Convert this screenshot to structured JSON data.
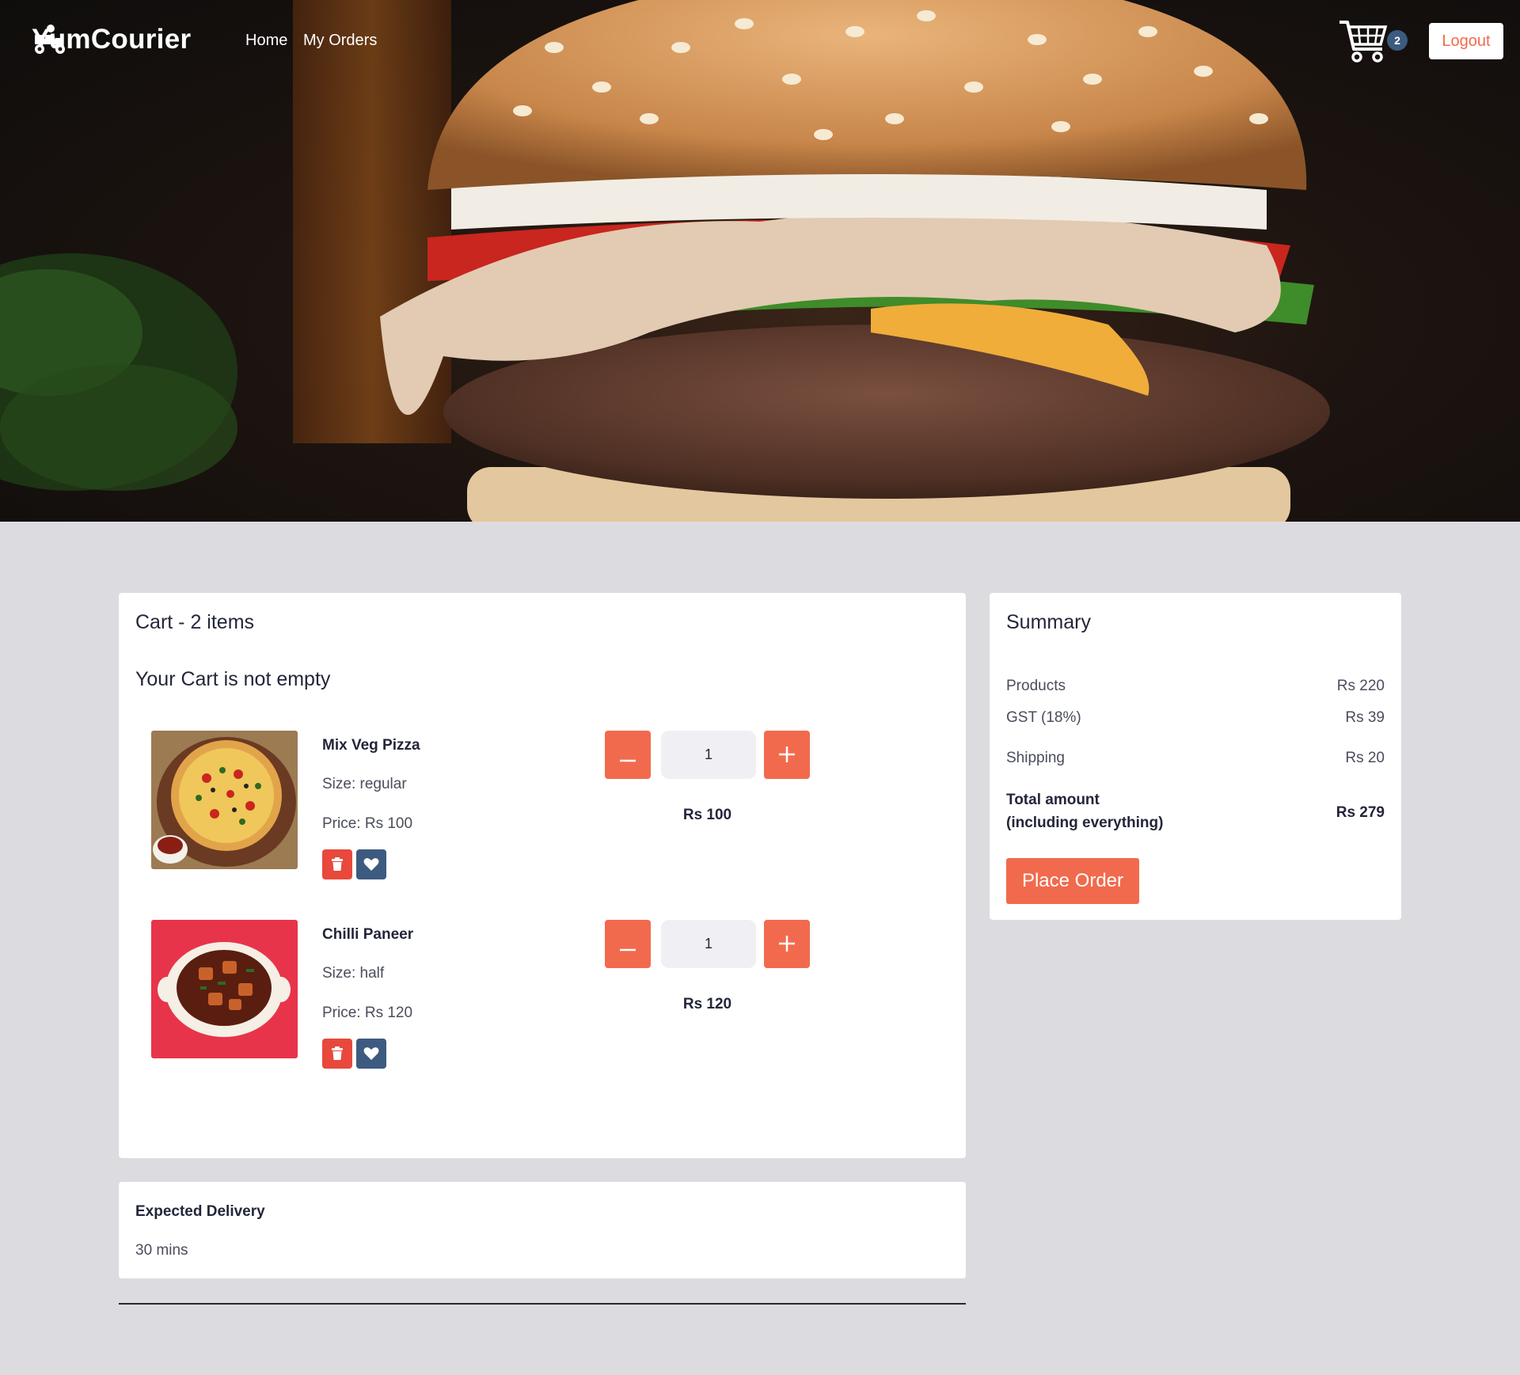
{
  "brand": {
    "name": "YumCourier",
    "icon": "delivery-scooter-icon"
  },
  "nav": {
    "links": [
      "Home",
      "My Orders"
    ],
    "cart_count": "2",
    "logout": "Logout"
  },
  "hero": {
    "image": "burger-photo"
  },
  "cart": {
    "title": "Cart - 2 items",
    "subtitle": "Your Cart is not empty",
    "items": [
      {
        "name": "Mix Veg Pizza",
        "size": "Size: regular",
        "price": "Price: Rs 100",
        "quantity": "1",
        "total": "Rs 100",
        "image": "pizza-photo"
      },
      {
        "name": "Chilli Paneer",
        "size": "Size: half",
        "price": "Price: Rs 120",
        "quantity": "1",
        "total": "Rs 120",
        "image": "chilli-paneer-photo"
      }
    ],
    "icons": {
      "delete": "trash-icon",
      "favorite": "heart-icon",
      "decrease": "minus-icon",
      "increase": "plus-icon"
    }
  },
  "summary": {
    "title": "Summary",
    "rows": [
      {
        "label": "Products",
        "value": "Rs 220"
      },
      {
        "label": "GST (18%)",
        "value": "Rs 39"
      },
      {
        "label": "Shipping",
        "value": "Rs 20"
      }
    ],
    "total_label_1": "Total amount",
    "total_label_2": "(including everything)",
    "total_value": "Rs 279",
    "button": "Place Order"
  },
  "delivery": {
    "label": "Expected Delivery",
    "value": "30 mins"
  },
  "colors": {
    "accent": "#f26a4d",
    "danger": "#e8493c",
    "navy": "#3d5a80",
    "page_bg": "#dcdce0"
  }
}
